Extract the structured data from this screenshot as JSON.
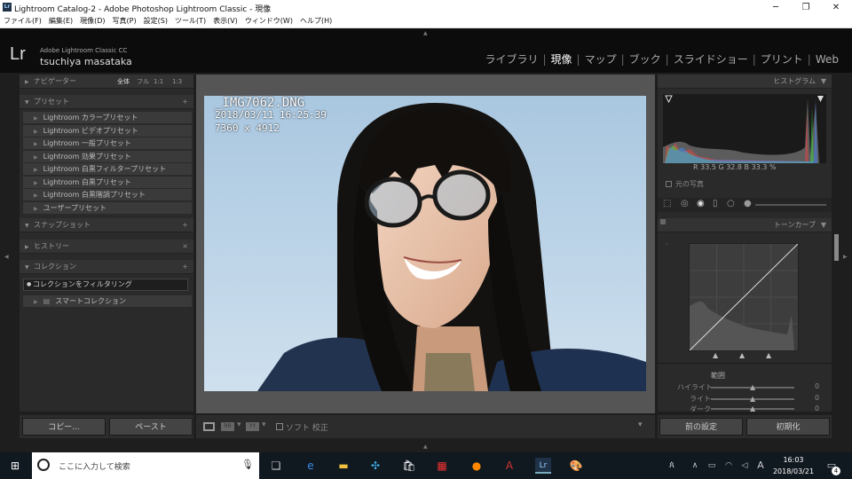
{
  "window": {
    "title": "Lightroom Catalog-2 - Adobe Photoshop Lightroom Classic - 現像",
    "icon": "lr-app-icon",
    "controls": [
      "minimize",
      "maximize",
      "close"
    ]
  },
  "menu": [
    "ファイル(F)",
    "編集(E)",
    "現像(D)",
    "写真(P)",
    "設定(S)",
    "ツール(T)",
    "表示(V)",
    "ウィンドウ(W)",
    "ヘルプ(H)"
  ],
  "header": {
    "logo": "Lr",
    "app_name": "Adobe Lightroom Classic CC",
    "user": "tsuchiya masataka",
    "modules": [
      "ライブラリ",
      "現像",
      "マップ",
      "ブック",
      "スライドショー",
      "プリント",
      "Web"
    ],
    "active_module": "現像"
  },
  "left_panel": {
    "navigator": {
      "label": "ナビゲーター",
      "zoom_options": [
        "全体",
        "フル",
        "1:1",
        "1:3"
      ]
    },
    "presets": {
      "label": "プリセット",
      "items": [
        "Lightroom カラープリセット",
        "Lightroom ビデオプリセット",
        "Lightroom 一般プリセット",
        "Lightroom 効果プリセット",
        "Lightroom 白黒フィルタープリセット",
        "Lightroom 白黒プリセット",
        "Lightroom 白黒階調プリセット",
        "ユーザープリセット"
      ]
    },
    "snapshot": {
      "label": "スナップショット"
    },
    "history": {
      "label": "ヒストリー"
    },
    "collections": {
      "label": "コレクション",
      "filter": "コレクションをフィルタリング",
      "smart": "スマートコレクション"
    },
    "copy_button": "コピー...",
    "paste_button": "ペースト"
  },
  "photo_info": {
    "filename": "_IMG7062.DNG",
    "datetime": "2018/03/11 16:25:39",
    "dimensions": "7360 x 4912"
  },
  "toolbar": {
    "soft_proof": "ソフト 校正"
  },
  "right_panel": {
    "histogram": {
      "label": "ヒストグラム",
      "readout": "R 33.5 G 32.8 B 33.3 %",
      "original_photo": "元の写真"
    },
    "tone_curve": {
      "label": "トーンカーブ",
      "range_label": "範囲",
      "sliders": [
        {
          "label": "ハイライト",
          "value": "0"
        },
        {
          "label": "ライト",
          "value": "0"
        },
        {
          "label": "ダーク",
          "value": "0"
        }
      ]
    },
    "previous_button": "前の設定",
    "reset_button": "初期化"
  },
  "taskbar": {
    "search_placeholder": "ここに入力して検索",
    "time": "16:03",
    "date": "2018/03/21",
    "ime": "A",
    "notification_count": "4"
  }
}
